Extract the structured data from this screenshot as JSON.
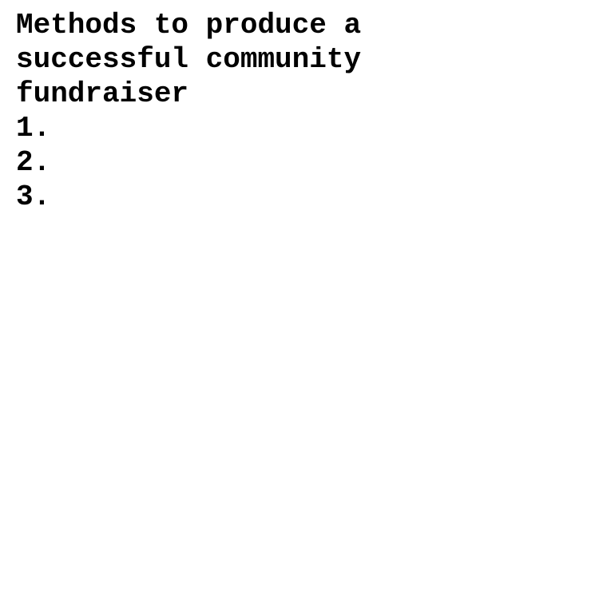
{
  "document": {
    "title_lines": [
      "Methods to produce a",
      "successful community",
      "fundraiser"
    ],
    "list_items": [
      "1.",
      "2.",
      "3."
    ]
  }
}
